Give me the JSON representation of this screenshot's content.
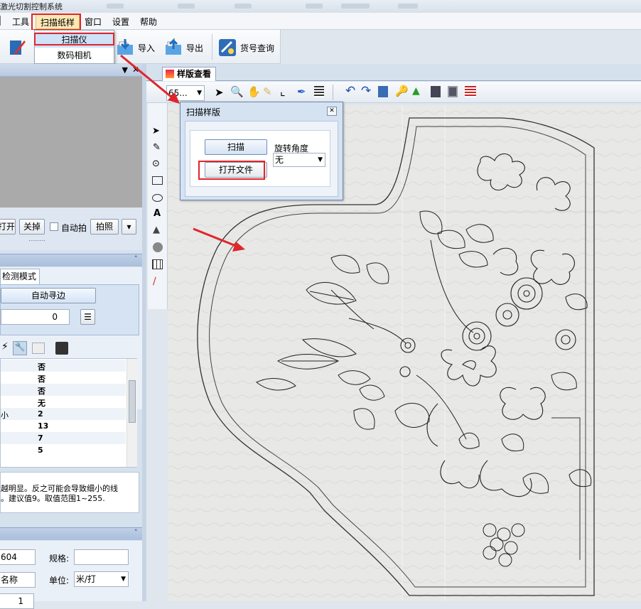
{
  "window": {
    "title": "激光切割控制系统"
  },
  "menubar": {
    "items": [
      "工具",
      "扫描纸样",
      "窗口",
      "设置",
      "帮助"
    ]
  },
  "toolbar": {
    "import_label": "导入",
    "export_label": "导出",
    "lookup_label": "货号查询"
  },
  "scan_menu": {
    "items": [
      "扫描仪",
      "数码相机"
    ]
  },
  "camera_panel": {
    "open_label": "打开",
    "close_label": "关掉",
    "auto_capture_label": "自动拍",
    "capture_label": "拍照"
  },
  "detect_panel": {
    "tab_label": "检测模式",
    "auto_edge_label": "自动寻边",
    "spin_value": "0",
    "props": [
      {
        "key": "",
        "value": "否"
      },
      {
        "key": "",
        "value": "否"
      },
      {
        "key": "",
        "value": "否"
      },
      {
        "key": "",
        "value": "无"
      },
      {
        "key": "小",
        "value": "2"
      },
      {
        "key": "",
        "value": "13"
      },
      {
        "key": "",
        "value": "7"
      },
      {
        "key": "",
        "value": "5"
      }
    ],
    "help_text_1": "越明显。反之可能会导致细小的线",
    "help_text_2": "。建议值9。取值范围1~255."
  },
  "info_panel": {
    "code_value": "604",
    "spec_label": "规格:",
    "name_value": "名称",
    "unit_label": "单位:",
    "unit_value": "米/打",
    "qty_value": "1"
  },
  "main": {
    "tab_label": "样版查看",
    "zoom_value": "65...",
    "dialog": {
      "title": "扫描样版",
      "scan_button": "扫描",
      "rotation_label": "旋转角度",
      "rotation_value": "无",
      "open_file_button": "打开文件"
    }
  },
  "colors": {
    "highlight_red": "#e0262b",
    "accent_blue": "#1e78c8"
  }
}
